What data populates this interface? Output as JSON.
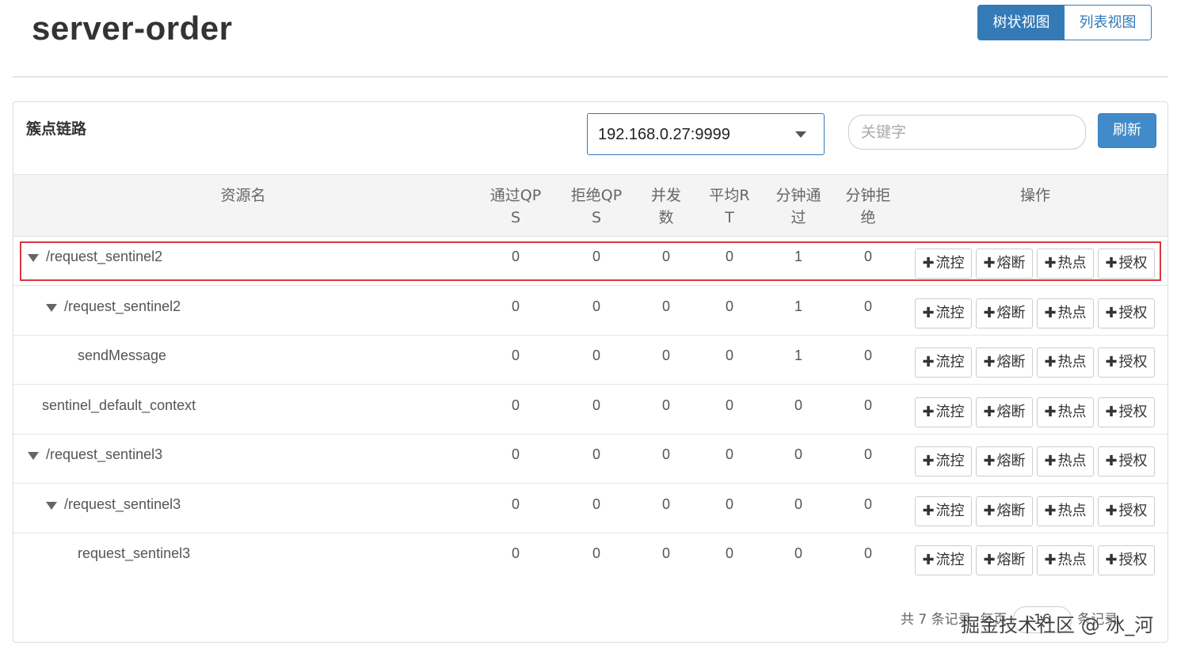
{
  "app": {
    "title": "server-order"
  },
  "view_toggle": {
    "tree": "树状视图",
    "list": "列表视图"
  },
  "panel": {
    "title": "簇点链路",
    "machine_select": {
      "value": "192.168.0.27:9999"
    },
    "search": {
      "placeholder": "关键字"
    },
    "refresh_label": "刷新"
  },
  "table": {
    "headers": {
      "resource": "资源名",
      "pass_qps": "通过QP\nS",
      "block_qps": "拒绝QP\nS",
      "thread": "并发\n数",
      "avg_rt": "平均R\nT",
      "minute_pass": "分钟通\n过",
      "minute_block": "分钟拒\n绝",
      "ops": "操作"
    },
    "buttons": {
      "flow": "流控",
      "degrade": "熔断",
      "hot": "热点",
      "auth": "授权"
    },
    "rows": [
      {
        "name": "/request_sentinel2",
        "pass_qps": "0",
        "block_qps": "0",
        "thread": "0",
        "avg_rt": "0",
        "minute_pass": "1",
        "minute_block": "0"
      },
      {
        "name": "/request_sentinel2",
        "pass_qps": "0",
        "block_qps": "0",
        "thread": "0",
        "avg_rt": "0",
        "minute_pass": "1",
        "minute_block": "0"
      },
      {
        "name": "sendMessage",
        "pass_qps": "0",
        "block_qps": "0",
        "thread": "0",
        "avg_rt": "0",
        "minute_pass": "1",
        "minute_block": "0"
      },
      {
        "name": "sentinel_default_context",
        "pass_qps": "0",
        "block_qps": "0",
        "thread": "0",
        "avg_rt": "0",
        "minute_pass": "0",
        "minute_block": "0"
      },
      {
        "name": "/request_sentinel3",
        "pass_qps": "0",
        "block_qps": "0",
        "thread": "0",
        "avg_rt": "0",
        "minute_pass": "0",
        "minute_block": "0"
      },
      {
        "name": "/request_sentinel3",
        "pass_qps": "0",
        "block_qps": "0",
        "thread": "0",
        "avg_rt": "0",
        "minute_pass": "0",
        "minute_block": "0"
      },
      {
        "name": "request_sentinel3",
        "pass_qps": "0",
        "block_qps": "0",
        "thread": "0",
        "avg_rt": "0",
        "minute_pass": "0",
        "minute_block": "0"
      }
    ]
  },
  "pager": {
    "prefix": "共 7 条记录, 每页",
    "page_size": "16",
    "suffix": "条记录"
  },
  "watermark": "掘金技术社区 @ 冰_河",
  "colors": {
    "primary": "#337ab7",
    "highlight": "#d9363e"
  },
  "icons": {
    "expand": "triangle-down-icon",
    "plus": "plus-icon",
    "dropdown": "caret-down-icon"
  }
}
